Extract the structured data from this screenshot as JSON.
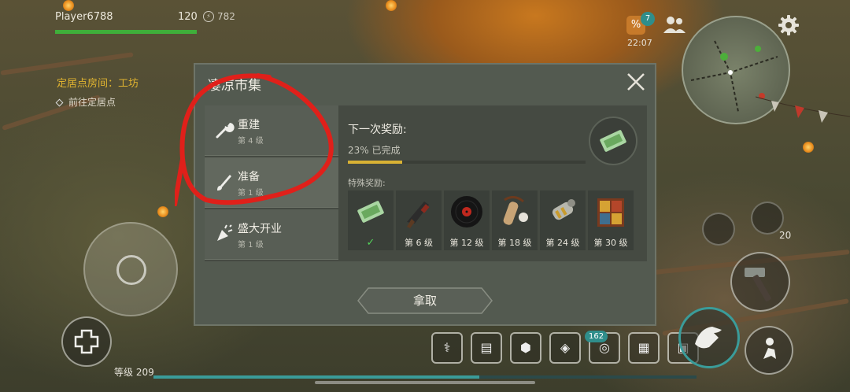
{
  "hud": {
    "player_name": "Player6788",
    "hp_value": "120",
    "hp_fraction": 1.0,
    "energy": "782",
    "quest_title": "定居点房间：工坊",
    "quest_sub": "前往定居点",
    "discount_symbol": "%",
    "discount_badge": "7",
    "clock": "22:07",
    "level_label": "等级 209",
    "item_count": "20",
    "bag_badge": "162"
  },
  "modal": {
    "title": "凄凉市集",
    "sidebar": [
      {
        "label": "重建",
        "level": "第 4 级",
        "icon": "wrench-icon"
      },
      {
        "label": "准备",
        "level": "第 1 级",
        "icon": "brush-icon"
      },
      {
        "label": "盛大开业",
        "level": "第 1 级",
        "icon": "confetti-icon"
      }
    ],
    "next_reward_title": "下一次奖励:",
    "progress_text": "23% 已完成",
    "progress_fraction": 0.23,
    "special_label": "特殊奖励:",
    "rewards": [
      {
        "icon": "ticket-icon",
        "label": "✓"
      },
      {
        "icon": "gun-icon",
        "label": "第 6 级"
      },
      {
        "icon": "vinyl-record-icon",
        "label": "第 12 级"
      },
      {
        "icon": "slingshot-icon",
        "label": "第 18 级"
      },
      {
        "icon": "engine-part-icon",
        "label": "第 24 级"
      },
      {
        "icon": "crate-icon",
        "label": "第 30 级"
      }
    ],
    "take_button": "拿取"
  },
  "colors": {
    "accent_yellow": "#d9b234",
    "hp_green": "#3fae3a",
    "annotation_red": "#e0201a",
    "teal": "#2f8e8b"
  }
}
